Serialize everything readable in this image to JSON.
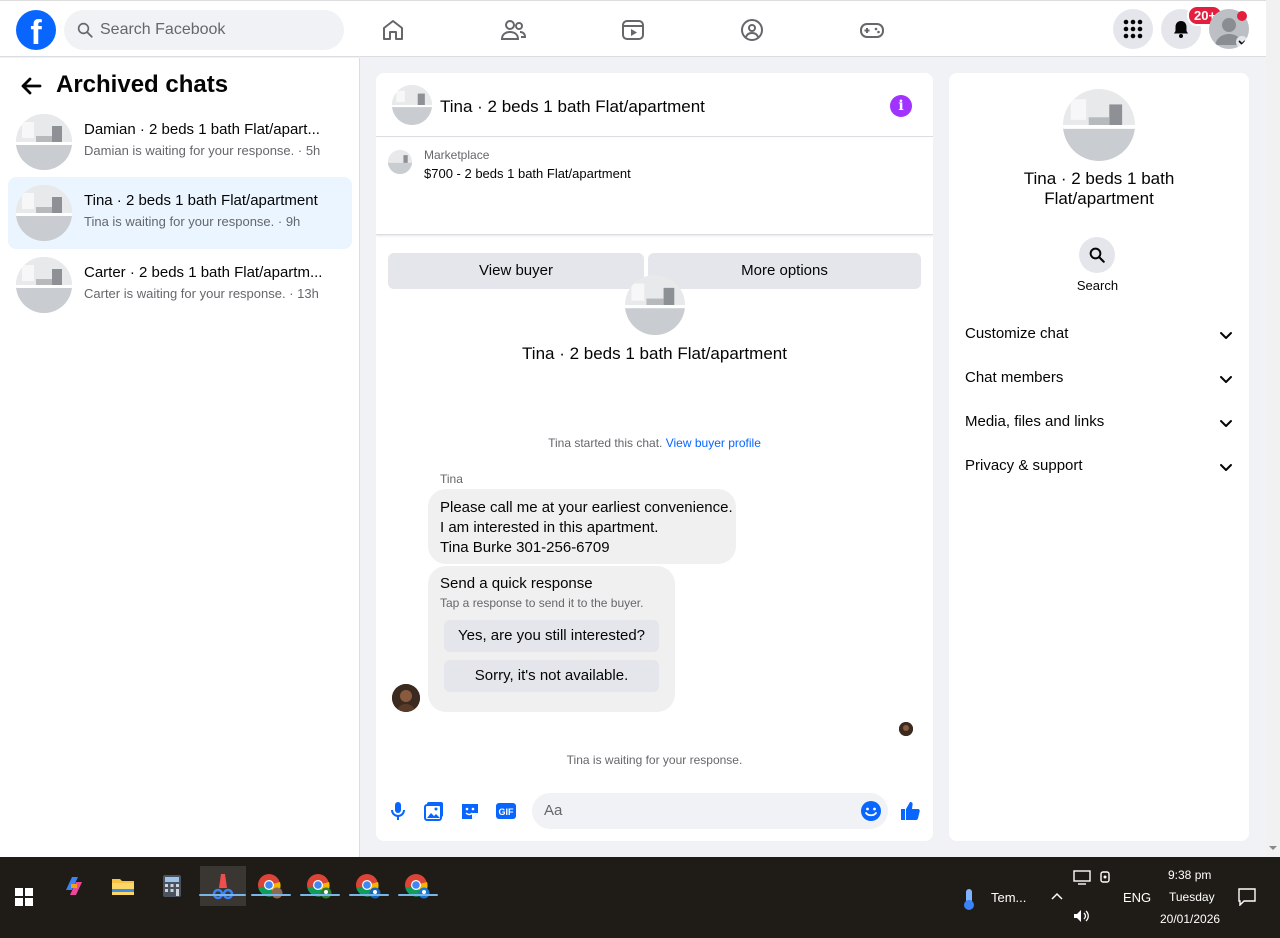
{
  "topbar": {
    "logo_letter": "f",
    "search_placeholder": "Search Facebook",
    "notifications_badge": "20+"
  },
  "left": {
    "title": "Archived chats",
    "chats": [
      {
        "title": "Damian · 2 beds 1 bath Flat/apart...",
        "subtitle": "Damian is waiting for your response. · 5h",
        "active": false
      },
      {
        "title": "Tina · 2 beds 1 bath Flat/apartment",
        "subtitle": "Tina is waiting for your response. · 9h",
        "active": true
      },
      {
        "title": "Carter · 2 beds 1 bath Flat/apartm...",
        "subtitle": "Carter is waiting for your response. · 13h",
        "active": false
      }
    ]
  },
  "conversation": {
    "title": "Tina · 2 beds 1 bath Flat/apartment",
    "marketplace_label": "Marketplace",
    "listing": "$700 - 2 beds 1 bath Flat/apartment",
    "view_buyer_label": "View buyer",
    "more_options_label": "More options",
    "center_title": "Tina · 2 beds 1 bath Flat/apartment",
    "started_text": "Tina started this chat.",
    "view_profile_link": "View buyer profile",
    "sender_name": "Tina",
    "message_lines": [
      "Please call me at your earliest convenience.",
      "I am interested in this apartment.",
      "Tina Burke 301-256-6709"
    ],
    "quick_response_title": "Send a quick response",
    "quick_response_sub": "Tap a response to send it to the buyer.",
    "quick_replies": [
      "Yes, are you still interested?",
      "Sorry, it's not available."
    ],
    "waiting_text": "Tina is waiting for your response.",
    "composer_placeholder": "Aa"
  },
  "details": {
    "title": "Tina · 2 beds 1 bath Flat/apartment",
    "search_label": "Search",
    "sections": [
      "Customize chat",
      "Chat members",
      "Media, files and links",
      "Privacy & support"
    ]
  },
  "taskbar": {
    "weather_label": "Tem...",
    "language": "ENG",
    "time": "9:38 pm",
    "day": "Tuesday",
    "date": "20/01/2026"
  },
  "colors": {
    "brand": "#0866ff",
    "info": "#a033ff",
    "badge": "#e41e3f",
    "active_row": "#ebf5ff"
  }
}
